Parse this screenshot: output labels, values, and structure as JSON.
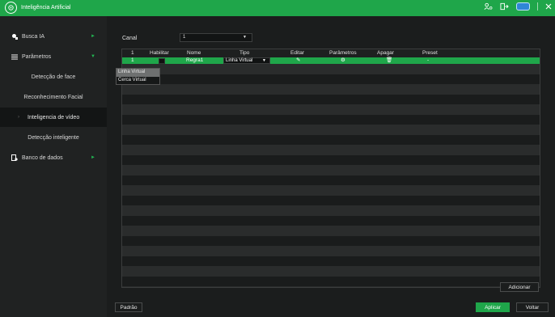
{
  "titlebar": {
    "title": "Inteligência Artificial",
    "icons": [
      "logo-icon",
      "user-settings-icon",
      "logout-icon",
      "badge-icon",
      "close-icon"
    ]
  },
  "sidebar": {
    "items": [
      {
        "label": "Busca IA",
        "arrow": "►"
      },
      {
        "label": "Parâmetros",
        "arrow": "▼"
      },
      {
        "label": "Detecção de face"
      },
      {
        "label": "Reconhecimento Facial"
      },
      {
        "label": "Inteligencia de vídeo",
        "caret": "›"
      },
      {
        "label": "Detecção inteligente"
      },
      {
        "label": "Banco de dados",
        "arrow": "►"
      }
    ]
  },
  "main": {
    "canal_label": "Canal",
    "canal_value": "1",
    "dropdown_arrow": "▼",
    "table": {
      "headers": [
        "1",
        "Habilitar",
        "Nome",
        "Tipo",
        "Editar",
        "Parâmetros",
        "Apagar",
        "Preset"
      ],
      "row": {
        "num": "1",
        "nome": "Regra1",
        "tipo": "Linha Virtual",
        "editar": "✎",
        "parametros": "⚙",
        "apagar": "🗑",
        "preset": "-"
      }
    },
    "tipo_options": [
      "Linha Virtual",
      "Cerca Virtual"
    ],
    "buttons": {
      "adicionar": "Adicionar",
      "padrao": "Padrão",
      "aplicar": "Aplicar",
      "voltar": "Voltar"
    }
  },
  "colors": {
    "accent": "#1fa64a",
    "background": "#1b1d1d",
    "sidebar": "#202222"
  }
}
